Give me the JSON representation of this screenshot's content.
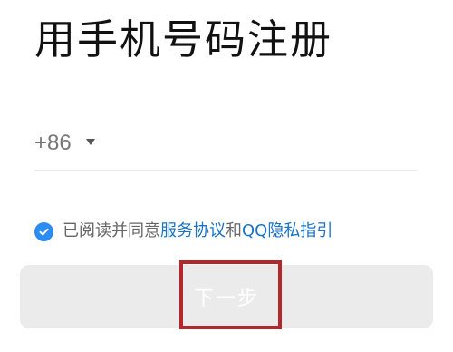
{
  "header": {
    "title": "用手机号码注册"
  },
  "phone": {
    "country_code": "+86",
    "value": ""
  },
  "agreement": {
    "checked": true,
    "text_prefix": "已阅读并同意",
    "link_service": "服务协议",
    "conjunction": "和",
    "link_privacy": "QQ隐私指引"
  },
  "actions": {
    "next_label": "下一步"
  },
  "colors": {
    "accent": "#2d8cf0",
    "link": "#1a73c8",
    "button_disabled": "#ebebeb",
    "highlight": "#b2282d"
  }
}
